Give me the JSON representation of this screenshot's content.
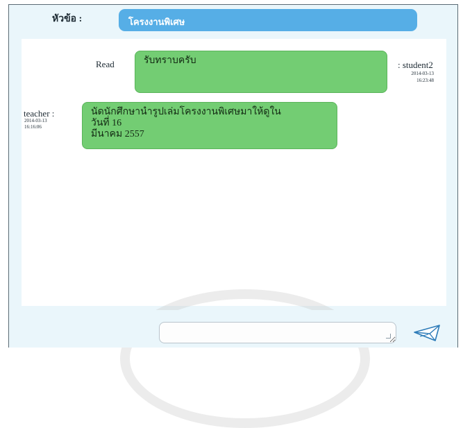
{
  "header": {
    "topic_label": "หัวข้อ :",
    "topic_value": "โครงงานพิเศษ"
  },
  "messages": [
    {
      "read_label": "Read",
      "text": "รับทราบครับ",
      "sender": ": student2",
      "date": "2014-03-13",
      "time": "16:23:48"
    },
    {
      "sender": "teacher :",
      "date": "2014-03-13",
      "time": "16:16:06",
      "text_lines": [
        "นัดนักศึกษานำรูปเล่มโครงงานพิเศษมาให้ดูใน",
        "วันที่ 16",
        "มีนาคม 2557"
      ]
    }
  ],
  "composer": {
    "input_value": "",
    "send_icon": "envelope-send-icon"
  },
  "colors": {
    "topic_bg": "#56aee6",
    "bubble_bg": "#73cd73",
    "panel_bg": "#eaf6fb"
  }
}
